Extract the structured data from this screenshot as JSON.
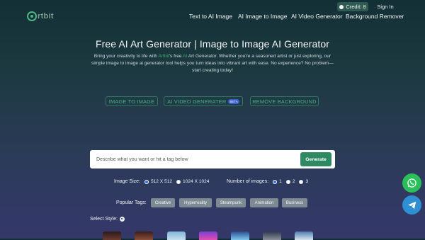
{
  "nav": {
    "logo_text": "rtbit",
    "links": [
      "Text to AI Image",
      "AI Image to Image",
      "AI Video Generator",
      "Background Remover"
    ],
    "credit": "Credit: 8",
    "signin": "Sign In"
  },
  "hero": {
    "title": "Free AI Art Generator | Image to Image AI Generator",
    "desc_1": "Bring your creativity to life with ",
    "desc_brand_1": "Artbit",
    "desc_2": "'s free ",
    "desc_brand_2": "AI",
    "desc_3": " Art Generator. Whether you're a seasoned artist or just exploring, our simple image to image ai generator tool helps you turn ideas into vibrant art with ease. No experience? No problem—start creating today!"
  },
  "mode_pills": {
    "image_to_image": "IMAGE TO IMAGE",
    "video": "AI VIDEO GENERATER",
    "beta": "BETA",
    "remove_bg": "REMOVE BACKGROUND"
  },
  "prompt": {
    "placeholder": "Describe what you want or hit a tag below",
    "generate": "Generate"
  },
  "image_size": {
    "label": "Image Size:",
    "options": [
      "512 X 512",
      "1024 X 1024"
    ],
    "selected": "512 X 512"
  },
  "num_images": {
    "label": "Number of images:",
    "options": [
      "1",
      "2",
      "3"
    ],
    "selected": "1"
  },
  "tags": {
    "label": "Popular Tags:",
    "items": [
      "Creative",
      "Hyperreality",
      "Steampunk",
      "Animation",
      "Business"
    ]
  },
  "style": {
    "label": "Select Style:"
  },
  "colors": {
    "accent": "#2f8a63",
    "brand_green": "#3ea86f",
    "whatsapp": "#2bbf5a",
    "telegram": "#2e8fd3"
  },
  "icons": [
    "logo-icon",
    "coin-icon",
    "palette-icon",
    "whatsapp-icon",
    "telegram-icon"
  ]
}
